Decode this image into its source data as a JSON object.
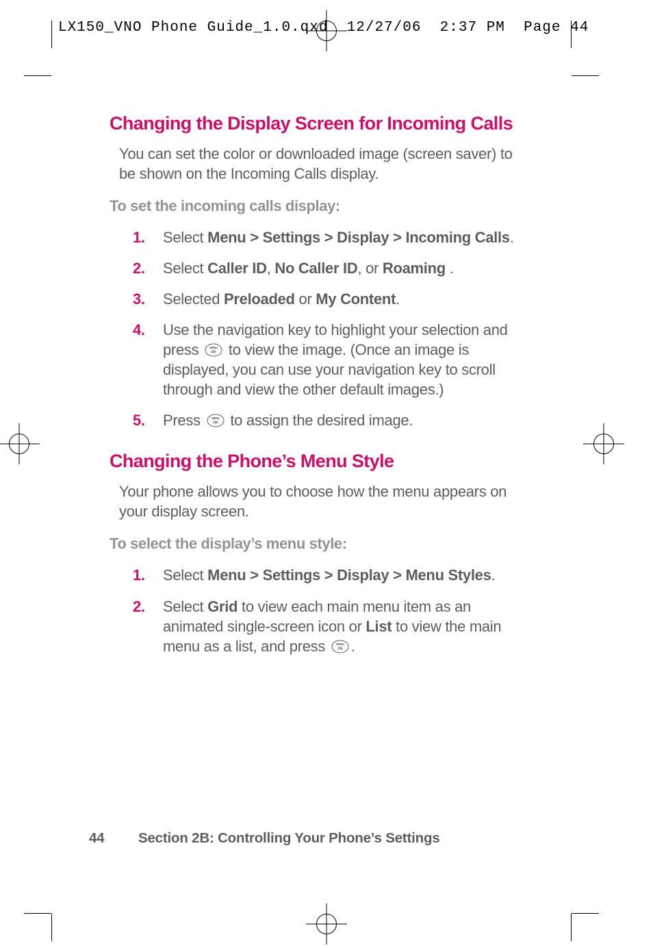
{
  "slug": "LX150_VNO Phone Guide_1.0.qxd  12/27/06  2:37 PM  Page 44",
  "section1": {
    "heading": "Changing the Display Screen for Incoming Calls",
    "intro": "You can set the color or downloaded image (screen saver) to be shown on the Incoming Calls display.",
    "subhead": "To set the incoming calls display:",
    "steps": {
      "s1": {
        "num": "1.",
        "pre": "Select ",
        "bold": "Menu > Settings > Display > Incoming Calls",
        "post": "."
      },
      "s2": {
        "num": "2.",
        "pre": "Select ",
        "b1": "Caller ID",
        "sep1": ", ",
        "b2": "No Caller ID",
        "sep2": ", or ",
        "b3": "Roaming ",
        "post": "."
      },
      "s3": {
        "num": "3.",
        "pre": "Selected ",
        "b1": "Preloaded",
        "sep1": " or ",
        "b2": "My Content",
        "post": "."
      },
      "s4": {
        "num": "4.",
        "pre": "Use the navigation key to highlight your selection and press ",
        "post": " to view the image. (Once an image is displayed, you can use your navigation key to scroll through and view the other default images.)"
      },
      "s5": {
        "num": "5.",
        "pre": "Press ",
        "post": " to assign the desired image."
      }
    }
  },
  "section2": {
    "heading": "Changing the Phone’s Menu Style",
    "intro": "Your phone allows you to choose how the menu appears on your display screen.",
    "subhead": "To select the display’s menu style:",
    "steps": {
      "s1": {
        "num": "1.",
        "pre": "Select ",
        "bold": "Menu > Settings > Display > Menu Styles",
        "post": "."
      },
      "s2": {
        "num": "2.",
        "pre": "Select ",
        "b1": "Grid",
        "mid1": " to view each main menu item as an animated single-screen icon or ",
        "b2": "List",
        "mid2": " to view the main menu as a list, and press ",
        "post": "."
      }
    }
  },
  "footer": {
    "page_number": "44",
    "title": "Section 2B: Controlling Your Phone’s Settings"
  },
  "icons": {
    "menuok_aria": "MENU/OK button"
  }
}
